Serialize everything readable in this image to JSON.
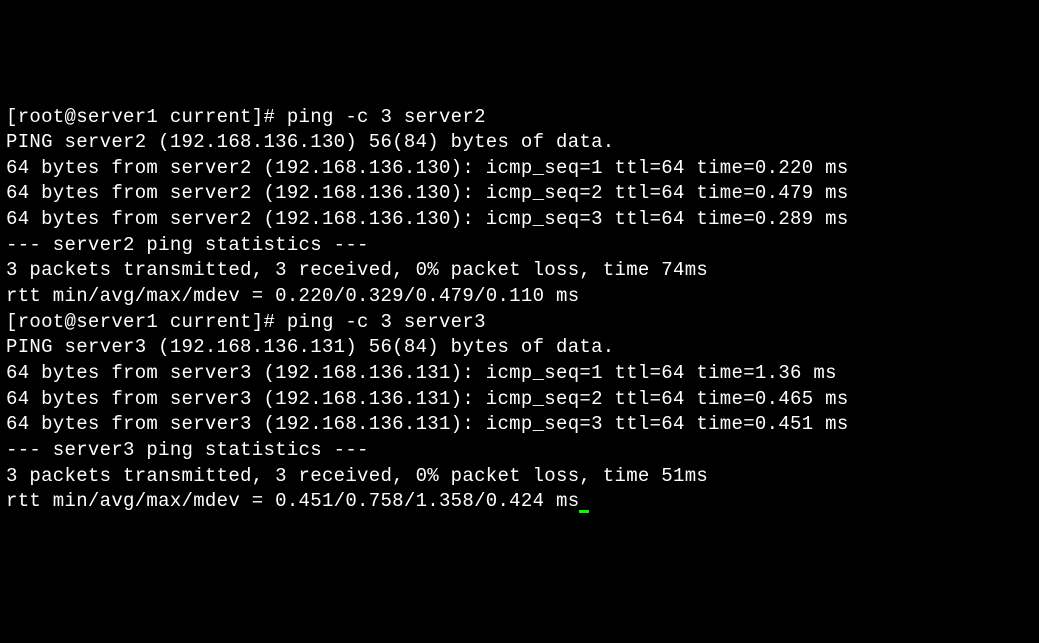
{
  "lines": [
    "[root@server1 current]# ping -c 3 server2",
    "PING server2 (192.168.136.130) 56(84) bytes of data.",
    "64 bytes from server2 (192.168.136.130): icmp_seq=1 ttl=64 time=0.220 ms",
    "64 bytes from server2 (192.168.136.130): icmp_seq=2 ttl=64 time=0.479 ms",
    "64 bytes from server2 (192.168.136.130): icmp_seq=3 ttl=64 time=0.289 ms",
    "",
    "--- server2 ping statistics ---",
    "3 packets transmitted, 3 received, 0% packet loss, time 74ms",
    "rtt min/avg/max/mdev = 0.220/0.329/0.479/0.110 ms",
    "[root@server1 current]# ping -c 3 server3",
    "PING server3 (192.168.136.131) 56(84) bytes of data.",
    "64 bytes from server3 (192.168.136.131): icmp_seq=1 ttl=64 time=1.36 ms",
    "64 bytes from server3 (192.168.136.131): icmp_seq=2 ttl=64 time=0.465 ms",
    "64 bytes from server3 (192.168.136.131): icmp_seq=3 ttl=64 time=0.451 ms",
    "",
    "--- server3 ping statistics ---",
    "3 packets transmitted, 3 received, 0% packet loss, time 51ms",
    "rtt min/avg/max/mdev = 0.451/0.758/1.358/0.424 ms"
  ]
}
